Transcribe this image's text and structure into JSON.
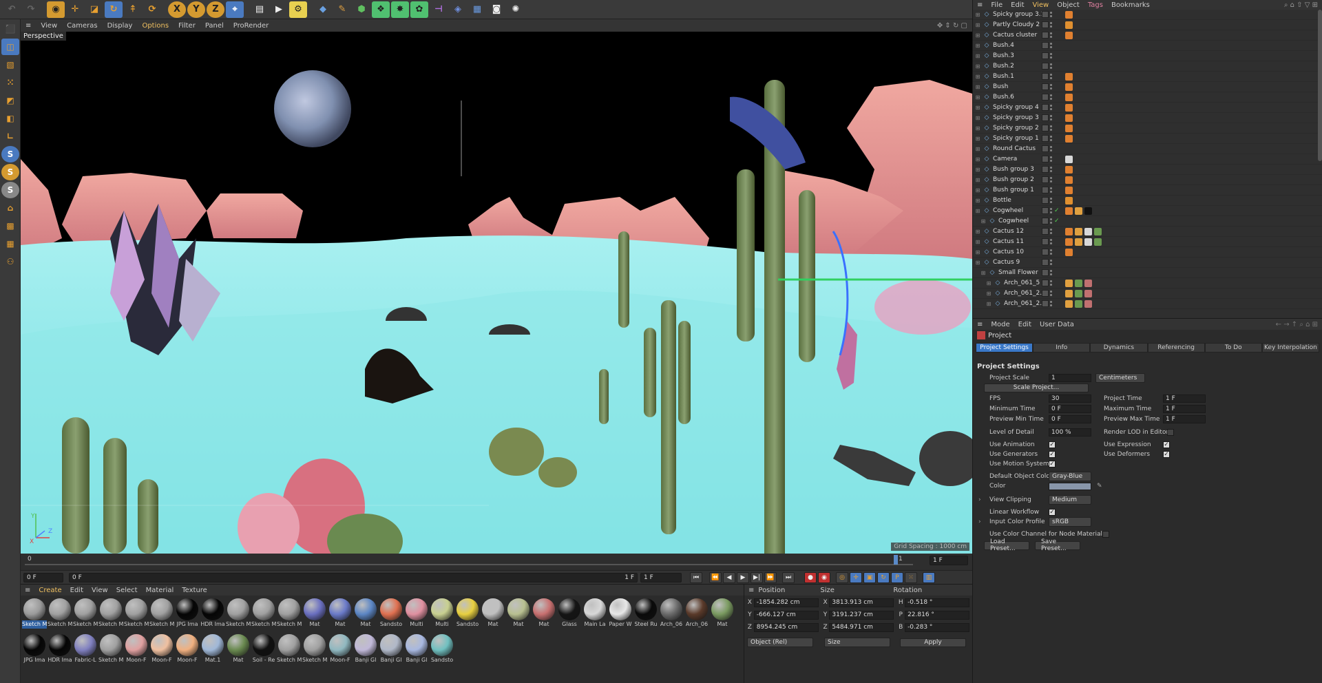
{
  "toolbar": {
    "icons": [
      "undo-icon",
      "redo-icon",
      "live-selection-icon",
      "move-icon",
      "scale-icon",
      "rotate-icon",
      "last-tool-icon",
      "recent-tools-icon",
      "lock-x-icon",
      "lock-y-icon",
      "lock-z-icon",
      "coordinate-system-icon",
      "render-region-icon",
      "render-viewport-icon",
      "render-settings-icon",
      "cube-icon",
      "pen-icon",
      "subdivision-icon",
      "cloner-icon",
      "deformer-icon",
      "field-icon",
      "environment-icon",
      "camera-icon",
      "light-icon"
    ],
    "lock_labels": [
      "X",
      "Y",
      "Z"
    ]
  },
  "viewport": {
    "menu": [
      "View",
      "Cameras",
      "Display",
      "Options",
      "Filter",
      "Panel",
      "ProRender"
    ],
    "active_menu": "Options",
    "label": "Perspective",
    "grid_spacing": "Grid Spacing : 1000 cm",
    "axis": {
      "y": "Y",
      "x": "X",
      "z": "Z"
    }
  },
  "timeline": {
    "ruler_start": "0",
    "current_frame_field": "0 F",
    "start_field": "0 F",
    "end_marker": "1 F",
    "end_field": "1 F",
    "right_field": "1 F",
    "ruler_end": "1"
  },
  "materials": {
    "menu": [
      "Create",
      "Edit",
      "View",
      "Select",
      "Material",
      "Texture"
    ],
    "row1": [
      {
        "name": "Sketch M",
        "color": "#9a9a9a",
        "selected": true
      },
      {
        "name": "Sketch M",
        "color": "#a0a0a0"
      },
      {
        "name": "Sketch M",
        "color": "#a0a0a0"
      },
      {
        "name": "Sketch M",
        "color": "#a0a0a0"
      },
      {
        "name": "Sketch M",
        "color": "#a0a0a0"
      },
      {
        "name": "Sketch M",
        "color": "#a0a0a0"
      },
      {
        "name": "JPG Ima",
        "color": "#050505"
      },
      {
        "name": "HDR Ima",
        "color": "#050505"
      },
      {
        "name": "Sketch M",
        "color": "#a0a0a0"
      },
      {
        "name": "Sketch M",
        "color": "#a0a0a0"
      },
      {
        "name": "Sketch M",
        "color": "#a0a0a0"
      },
      {
        "name": "Mat",
        "color": "#6a6fc0"
      },
      {
        "name": "Mat",
        "color": "#6a7ac8"
      },
      {
        "name": "Mat",
        "color": "#5c86c4"
      },
      {
        "name": "Sandsto",
        "color": "#e07050"
      },
      {
        "name": "Multi",
        "color": "#e090a0"
      },
      {
        "name": "Multi",
        "color": "#c8d090"
      },
      {
        "name": "Sandsto",
        "color": "#e8d040"
      },
      {
        "name": "Mat",
        "color": "#c0c0c0"
      },
      {
        "name": "Mat",
        "color": "#b8c090"
      },
      {
        "name": "Mat",
        "color": "#c87070"
      },
      {
        "name": "Glass",
        "color": "#151515"
      },
      {
        "name": "Main La",
        "color": "#d8d8d8"
      },
      {
        "name": "Paper W",
        "color": "#e8e8e8"
      },
      {
        "name": "Steel Ru",
        "color": "#0a0a0a"
      },
      {
        "name": "Arch_06",
        "color": "#6a6a6a"
      },
      {
        "name": "Arch_06",
        "color": "#5a3a2a"
      },
      {
        "name": "Mat",
        "color": "#7a9a60"
      }
    ],
    "row2": [
      {
        "name": "JPG Ima",
        "color": "#050505"
      },
      {
        "name": "HDR Ima",
        "color": "#050505"
      },
      {
        "name": "Fabric-L",
        "color": "#8080c0"
      },
      {
        "name": "Sketch M",
        "color": "#a0a0a0"
      },
      {
        "name": "Moon-F",
        "color": "#e0a0a0"
      },
      {
        "name": "Moon-F",
        "color": "#f0c0a0"
      },
      {
        "name": "Moon-F",
        "color": "#f0b080"
      },
      {
        "name": "Mat.1",
        "color": "#a0b8d8"
      },
      {
        "name": "Mat",
        "color": "#6a8a50"
      },
      {
        "name": "Soil - Re",
        "color": "#101010"
      },
      {
        "name": "Sketch M",
        "color": "#a0a0a0"
      },
      {
        "name": "Sketch M",
        "color": "#a0a0a0"
      },
      {
        "name": "Moon-F",
        "color": "#90b8c0"
      },
      {
        "name": "Banji Gl",
        "color": "#c0b8d8"
      },
      {
        "name": "Banji Gl",
        "color": "#b0b8c8"
      },
      {
        "name": "Banji Gl",
        "color": "#a8b8e0"
      },
      {
        "name": "Sandsto",
        "color": "#70c0c0"
      }
    ]
  },
  "coords": {
    "headers": [
      "Position",
      "Size",
      "Rotation"
    ],
    "rows": [
      {
        "axis": "X",
        "pos": "-1854.282 cm",
        "sax": "X",
        "size": "3813.913 cm",
        "rax": "H",
        "rot": "-0.518 °"
      },
      {
        "axis": "Y",
        "pos": "-666.127 cm",
        "sax": "Y",
        "size": "3191.237 cm",
        "rax": "P",
        "rot": "22.816 °"
      },
      {
        "axis": "Z",
        "pos": "8954.245 cm",
        "sax": "Z",
        "size": "5484.971 cm",
        "rax": "B",
        "rot": "-0.283 °"
      }
    ],
    "mode_dropdown": "Object (Rel)",
    "size_dropdown": "Size",
    "apply_label": "Apply"
  },
  "objects": {
    "menu": [
      "File",
      "Edit",
      "View",
      "Object",
      "Tags",
      "Bookmarks"
    ],
    "active_menu": "View",
    "highlight_menu": "Tags",
    "rows": [
      {
        "name": "Spicky group 3.1",
        "indent": 0,
        "tags": [
          "#e08030"
        ]
      },
      {
        "name": "Partly Cloudy 2",
        "indent": 0,
        "tags": [
          "#e09030"
        ]
      },
      {
        "name": "Cactus cluster",
        "indent": 0,
        "tags": [
          "#e08030"
        ]
      },
      {
        "name": "Bush.4",
        "indent": 0,
        "tags": []
      },
      {
        "name": "Bush.3",
        "indent": 0,
        "tags": []
      },
      {
        "name": "Bush.2",
        "indent": 0,
        "tags": []
      },
      {
        "name": "Bush.1",
        "indent": 0,
        "tags": [
          "#e08030"
        ]
      },
      {
        "name": "Bush",
        "indent": 0,
        "tags": [
          "#e08030"
        ]
      },
      {
        "name": "Bush.6",
        "indent": 0,
        "tags": [
          "#e08030"
        ]
      },
      {
        "name": "Spicky group 4",
        "indent": 0,
        "tags": [
          "#e08030"
        ]
      },
      {
        "name": "Spicky group 3",
        "indent": 0,
        "tags": [
          "#e08030"
        ]
      },
      {
        "name": "Spicky group 2",
        "indent": 0,
        "tags": [
          "#e08030"
        ]
      },
      {
        "name": "Spicky group 1",
        "indent": 0,
        "tags": [
          "#e08030"
        ]
      },
      {
        "name": "Round Cactus",
        "indent": 0,
        "tags": []
      },
      {
        "name": "Camera",
        "indent": 0,
        "tags": [
          "#d8d8d8"
        ]
      },
      {
        "name": "Bush group 3",
        "indent": 0,
        "tags": [
          "#e08030"
        ]
      },
      {
        "name": "Bush group 2",
        "indent": 0,
        "tags": [
          "#e08030"
        ]
      },
      {
        "name": "Bush group 1",
        "indent": 0,
        "tags": [
          "#e08030"
        ]
      },
      {
        "name": "Bottle",
        "indent": 0,
        "tags": [
          "#e09030"
        ]
      },
      {
        "name": "Cogwheel",
        "indent": 0,
        "tags": [
          "#e08030",
          "#e0a040",
          "#101010"
        ],
        "check": true
      },
      {
        "name": "Cogwheel",
        "indent": 1,
        "tags": [],
        "check": true
      },
      {
        "name": "Cactus 12",
        "indent": 0,
        "tags": [
          "#e08030",
          "#e0a040",
          "#d8d8d8",
          "#6a9a50"
        ]
      },
      {
        "name": "Cactus 11",
        "indent": 0,
        "tags": [
          "#e08030",
          "#e0a040",
          "#d8d8d8",
          "#6a9a50"
        ]
      },
      {
        "name": "Cactus 10",
        "indent": 0,
        "tags": [
          "#e08030"
        ]
      },
      {
        "name": "Cactus 9",
        "indent": 0,
        "tags": []
      },
      {
        "name": "Small Flower",
        "indent": 1,
        "tags": []
      },
      {
        "name": "Arch_061_5",
        "indent": 2,
        "tags": [
          "#e0a040",
          "#6a9a50",
          "#c07070"
        ]
      },
      {
        "name": "Arch_061_2.3",
        "indent": 2,
        "tags": [
          "#e0a040",
          "#6a9a50",
          "#c07070"
        ]
      },
      {
        "name": "Arch_061_2.2",
        "indent": 2,
        "tags": [
          "#e0a040",
          "#6a9a50",
          "#c07070"
        ]
      }
    ]
  },
  "attributes": {
    "menu": [
      "Mode",
      "Edit",
      "User Data"
    ],
    "object": "Project",
    "tabs": [
      "Project Settings",
      "Info",
      "Dynamics",
      "Referencing",
      "To Do",
      "Key Interpolation"
    ],
    "section": "Project Settings",
    "project_scale_label": "Project Scale",
    "project_scale_value": "1",
    "project_scale_unit": "Centimeters",
    "scale_project_button": "Scale Project...",
    "fps_label": "FPS",
    "fps_value": "30",
    "project_time_label": "Project Time",
    "project_time_value": "1 F",
    "min_time_label": "Minimum Time",
    "min_time_value": "0 F",
    "max_time_label": "Maximum Time",
    "max_time_value": "1 F",
    "preview_min_label": "Preview Min Time",
    "preview_min_value": "0 F",
    "preview_max_label": "Preview Max Time",
    "preview_max_value": "1 F",
    "lod_label": "Level of Detail",
    "lod_value": "100 %",
    "render_lod_label": "Render LOD in Editor",
    "use_animation_label": "Use Animation",
    "use_expression_label": "Use Expression",
    "use_generators_label": "Use Generators",
    "use_deformers_label": "Use Deformers",
    "use_motion_label": "Use Motion System",
    "default_color_label": "Default Object Color",
    "default_color_value": "Gray-Blue",
    "color_label": "Color",
    "color_swatch": "#8896aa",
    "view_clipping_label": "View Clipping",
    "view_clipping_value": "Medium",
    "linear_workflow_label": "Linear Workflow",
    "input_profile_label": "Input Color Profile",
    "input_profile_value": "sRGB",
    "color_channel_label": "Use Color Channel for Node Material",
    "load_preset": "Load Preset...",
    "save_preset": "Save Preset..."
  }
}
